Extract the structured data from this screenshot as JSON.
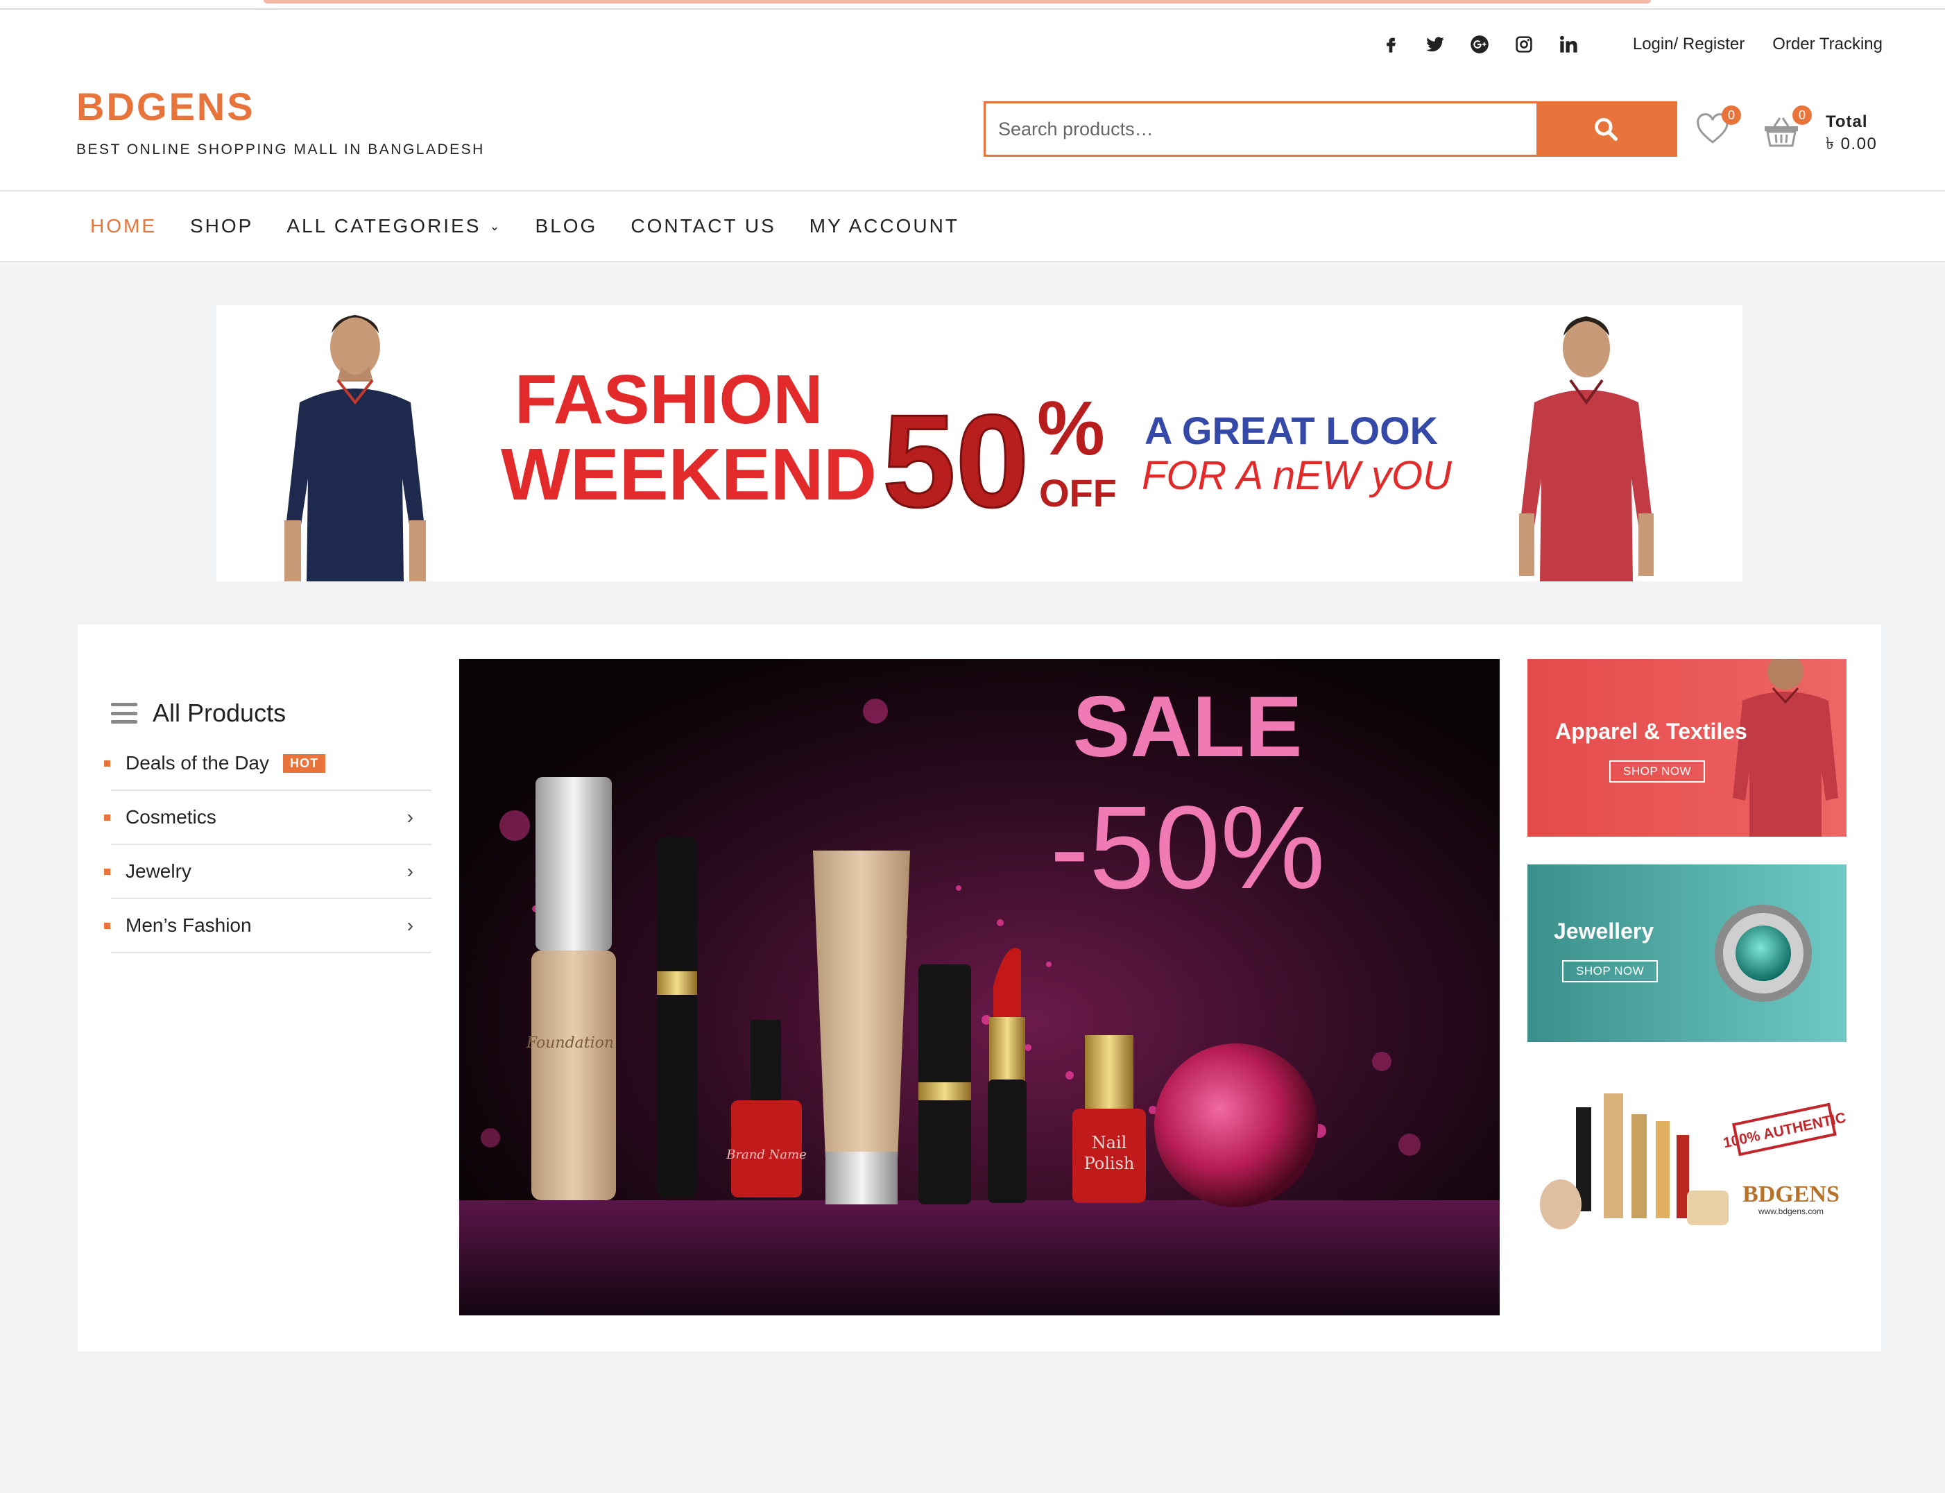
{
  "topbar": {
    "social_icons": [
      "facebook-icon",
      "twitter-icon",
      "google-plus-icon",
      "instagram-icon",
      "linkedin-icon"
    ],
    "login_label": "Login/ Register",
    "order_tracking_label": "Order Tracking"
  },
  "brand": {
    "name": "BDGENS",
    "tagline": "BEST ONLINE SHOPPING MALL IN BANGLADESH",
    "accent_color": "#e8743b"
  },
  "search": {
    "placeholder": "Search products…"
  },
  "header_icons": {
    "wishlist_count": "0",
    "cart_count": "0",
    "total_label": "Total",
    "total_amount": "৳ 0.00"
  },
  "nav": {
    "items": [
      {
        "label": "HOME",
        "active": true
      },
      {
        "label": "SHOP"
      },
      {
        "label": "ALL CATEGORIES",
        "has_dropdown": true
      },
      {
        "label": "BLOG"
      },
      {
        "label": "CONTACT US"
      },
      {
        "label": "MY ACCOUNT"
      }
    ]
  },
  "promo_banner": {
    "line1": "FASHION",
    "line2": "WEEKEND",
    "discount": "50",
    "percent": "%",
    "off": "OFF",
    "slogan1": "A GREAT LOOK",
    "slogan2": "FOR A nEW yOU"
  },
  "categories": {
    "title": "All Products",
    "items": [
      {
        "label": "Deals of the Day",
        "badge": "HOT"
      },
      {
        "label": "Cosmetics"
      },
      {
        "label": "Jewelry"
      },
      {
        "label": "Men’s Fashion"
      }
    ]
  },
  "hero": {
    "sale": "SALE",
    "discount": "-50%",
    "product_labels": {
      "foundation": "Foundation",
      "brand_name": "Brand Name",
      "nail": "Nail",
      "polish": "Polish"
    }
  },
  "side_banners": [
    {
      "title": "Apparel & Textiles",
      "button": "SHOP NOW"
    },
    {
      "title": "Jewellery",
      "button": "SHOP NOW"
    },
    {
      "stamp": "100% AUTHENTIC",
      "brand": "BDGENS",
      "url": "www.bdgens.com"
    }
  ]
}
